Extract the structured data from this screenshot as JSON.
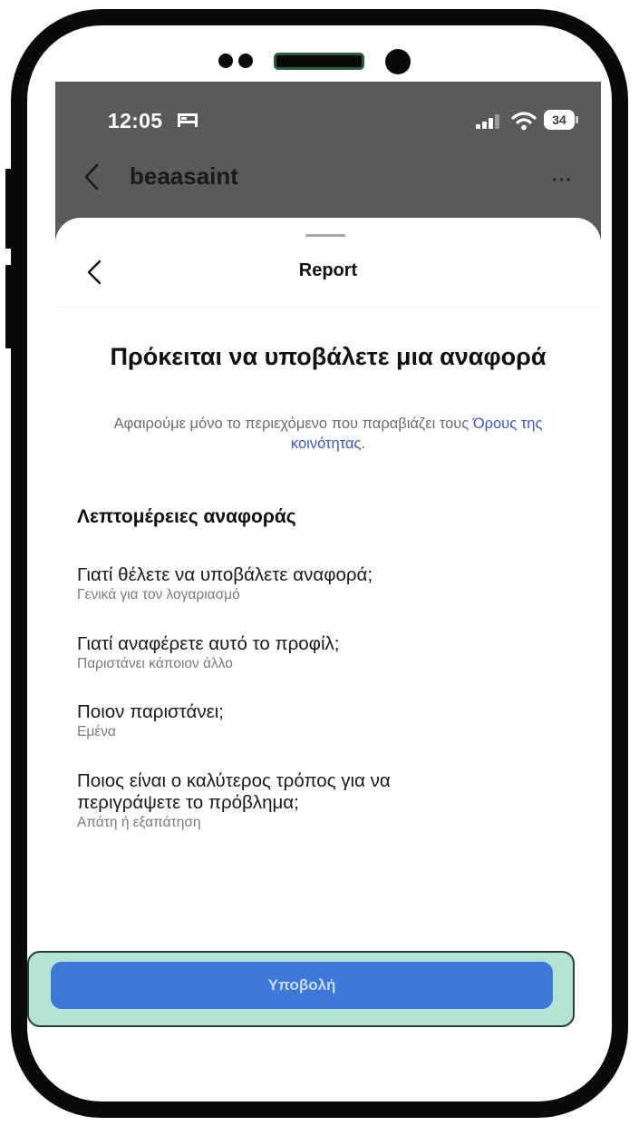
{
  "status_bar": {
    "time": "12:05",
    "battery": "34"
  },
  "profile_header": {
    "username": "beaasaint",
    "more": "···"
  },
  "sheet": {
    "title": "Report",
    "headline": "Πρόκειται να υποβάλετε μια αναφορά",
    "subtext_before": "Αφαιρούμε μόνο το περιεχόμενο που παραβιάζει τους ",
    "subtext_link": "Όρους της κοινότητας",
    "subtext_after": ".",
    "section_title": "Λεπτομέρειες αναφοράς",
    "items": [
      {
        "question": "Γιατί θέλετε να υποβάλετε αναφορά;",
        "answer": "Γενικά για τον λογαριασμό"
      },
      {
        "question": "Γιατί αναφέρετε αυτό το προφίλ;",
        "answer": "Παριστάνει κάποιον άλλο"
      },
      {
        "question": "Ποιον παριστάνει;",
        "answer": "Εμένα"
      },
      {
        "question": "Ποιος είναι ο καλύτερος τρόπος για να περιγράψετε το πρόβλημα;",
        "answer": "Απάτη ή εξαπάτηση"
      }
    ],
    "submit_label": "Υποβολή"
  },
  "icons": {
    "status": [
      "bed-icon",
      "signal-icon",
      "wifi-icon",
      "battery-icon"
    ],
    "navigation": [
      "chevron-left-icon",
      "more-icon"
    ]
  },
  "colors": {
    "accent": "#3d78d8",
    "link": "#3a56c9",
    "status_bar_bg": "#5a5a5a",
    "highlight": "#b3e3d2"
  }
}
